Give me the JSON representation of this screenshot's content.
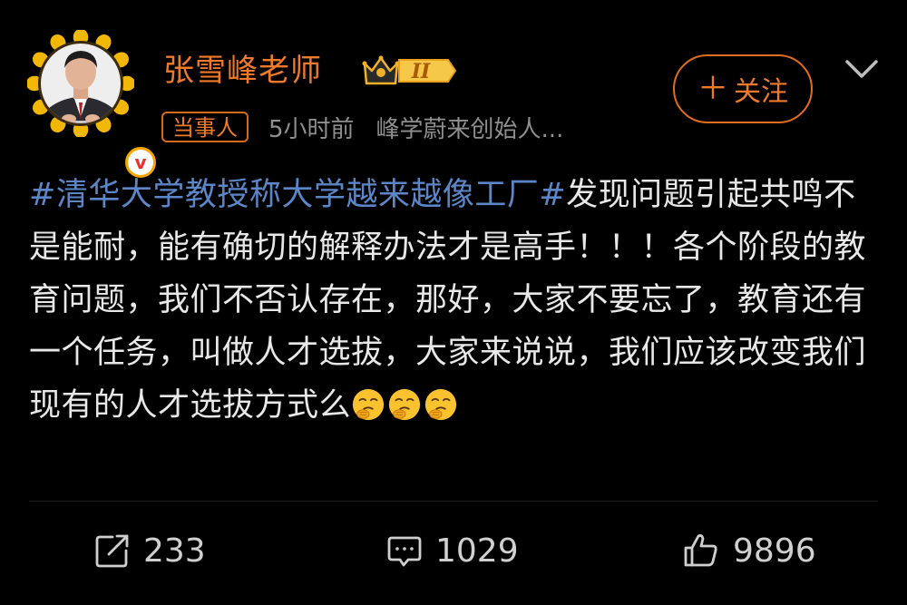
{
  "author": {
    "name": "张雪峰老师",
    "badge_text": "当事人",
    "verified_mark": "v",
    "vip_level": "II",
    "post_time": "5小时前",
    "source": "峰学蔚来创始人..."
  },
  "follow_button": {
    "plus": "＋",
    "label": "关注"
  },
  "post": {
    "hashtag_1": "#清华大学教授称大学越来越像工厂#",
    "text": "发现问题引起共鸣不是能耐，能有确切的解释办法才是高手！！！各个阶段的教育问题，我们不否认存在，那好，大家不要忘了，教育还有一个任务，叫做人才选拔，大家来说说，我们应该改变我们现有的人才选拔方式么",
    "emojis": [
      "thinking-face-emoji",
      "thinking-face-emoji",
      "thinking-face-emoji"
    ]
  },
  "actions": {
    "share_count": "233",
    "comment_count": "1029",
    "like_count": "9896"
  },
  "colors": {
    "accent": "#ef7a2c",
    "hashtag": "#5b86c8",
    "background": "#000000",
    "text": "#e8e8e8",
    "muted": "#8f8f8f"
  },
  "icons": {
    "more": "chevron-down-icon",
    "share": "share-icon",
    "comment": "comment-icon",
    "like": "thumbs-up-icon"
  }
}
